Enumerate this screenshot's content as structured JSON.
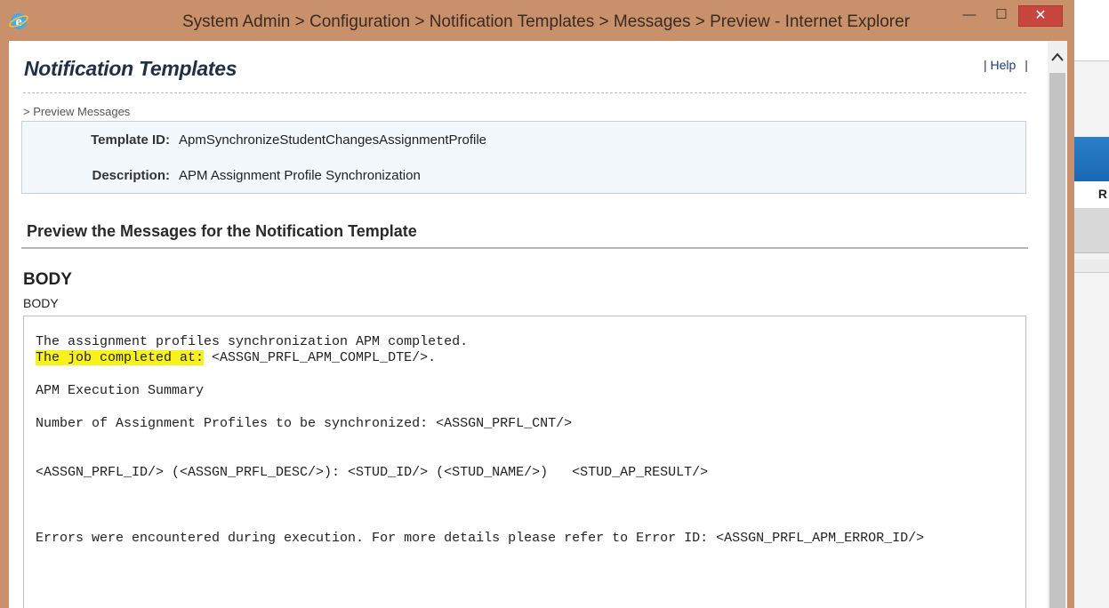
{
  "window": {
    "title": "System Admin > Configuration > Notification Templates > Messages > Preview - Internet Explorer",
    "minimize": "—",
    "maximize": "☐",
    "close": "✕"
  },
  "background_app": {
    "partial_label": "R"
  },
  "page": {
    "title": "Notification Templates",
    "help_separator_left": "|",
    "help_label": "Help",
    "help_separator_right": "|",
    "breadcrumb": "> Preview Messages"
  },
  "template_info": {
    "template_id_label": "Template ID:",
    "template_id_value": "ApmSynchronizeStudentChangesAssignmentProfile",
    "description_label": "Description:",
    "description_value": "APM Assignment Profile Synchronization"
  },
  "preview": {
    "section_title": "Preview the Messages for the Notification Template",
    "body_heading": "BODY",
    "body_label": "BODY",
    "lines": {
      "l1": "The assignment profiles synchronization APM completed.",
      "l2_highlight": "The job completed at:",
      "l2_rest": " <ASSGN_PRFL_APM_COMPL_DTE/>.",
      "l3": "APM Execution Summary",
      "l4": "Number of Assignment Profiles to be synchronized: <ASSGN_PRFL_CNT/>",
      "l5": "<ASSGN_PRFL_ID/> (<ASSGN_PRFL_DESC/>): <STUD_ID/> (<STUD_NAME/>)   <STUD_AP_RESULT/>",
      "l6": "Errors were encountered during execution. For more details please refer to Error ID: <ASSGN_PRFL_APM_ERROR_ID/>"
    }
  },
  "icons": {
    "browser": "internet-explorer-icon",
    "scroll_up": "chevron-up-icon"
  },
  "colors": {
    "window_frame": "#c9916b",
    "close_button": "#c8463d",
    "highlight": "#f7f21c",
    "info_box_bg": "#f3f8fc"
  }
}
